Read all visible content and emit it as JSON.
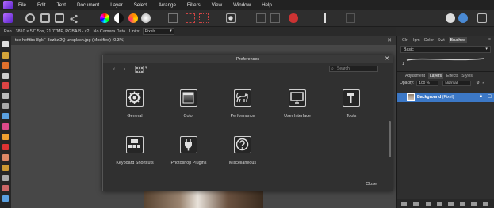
{
  "menu": [
    "File",
    "Edit",
    "Text",
    "Document",
    "Layer",
    "Select",
    "Arrange",
    "Filters",
    "View",
    "Window",
    "Help"
  ],
  "context_bar": {
    "pan_label": "Pan",
    "image_info": "3810 × 5715px, 21.77MP, RGBA/8 - c2",
    "camera": "No Camera Data",
    "units_label": "Units:",
    "units_value": "Pixels"
  },
  "document_tab": {
    "title": "tse-hefftbs-8gkF-8ezbzl2Q-unsplash.jpg (Modified) (0.3%)"
  },
  "right_panel": {
    "top_tabs": [
      "Clr",
      "Hgm",
      "Color",
      "Swt",
      "Brushes"
    ],
    "active_top_tab": "Brushes",
    "brush_category": "Basic",
    "brush_size_label": "1",
    "sub_tabs": [
      "Adjustment",
      "Layers",
      "Effects",
      "Styles"
    ],
    "active_sub_tab": "Layers",
    "opacity_label": "Opacity:",
    "opacity_value": "100 %",
    "blend_mode": "Normal",
    "layer": {
      "name": "Background",
      "type": "(Pixel)"
    }
  },
  "dialog": {
    "title": "Preferences",
    "search_placeholder": "Search",
    "close_button": "Close",
    "items": [
      {
        "label": "General",
        "icon": "gear-icon"
      },
      {
        "label": "Color",
        "icon": "color-gradient-icon"
      },
      {
        "label": "Performance",
        "icon": "cat-icon"
      },
      {
        "label": "User Interface",
        "icon": "monitor-icon"
      },
      {
        "label": "Tools",
        "icon": "hammer-icon"
      },
      {
        "label": "Keyboard Shortcuts",
        "icon": "keyboard-icon"
      },
      {
        "label": "Photoshop Plugins",
        "icon": "plug-icon"
      },
      {
        "label": "Miscellaneous",
        "icon": "question-icon"
      }
    ]
  },
  "colors": {
    "accent": "#3c78c6",
    "dialog_bg": "#303030",
    "canvas_bg": "#474747"
  }
}
